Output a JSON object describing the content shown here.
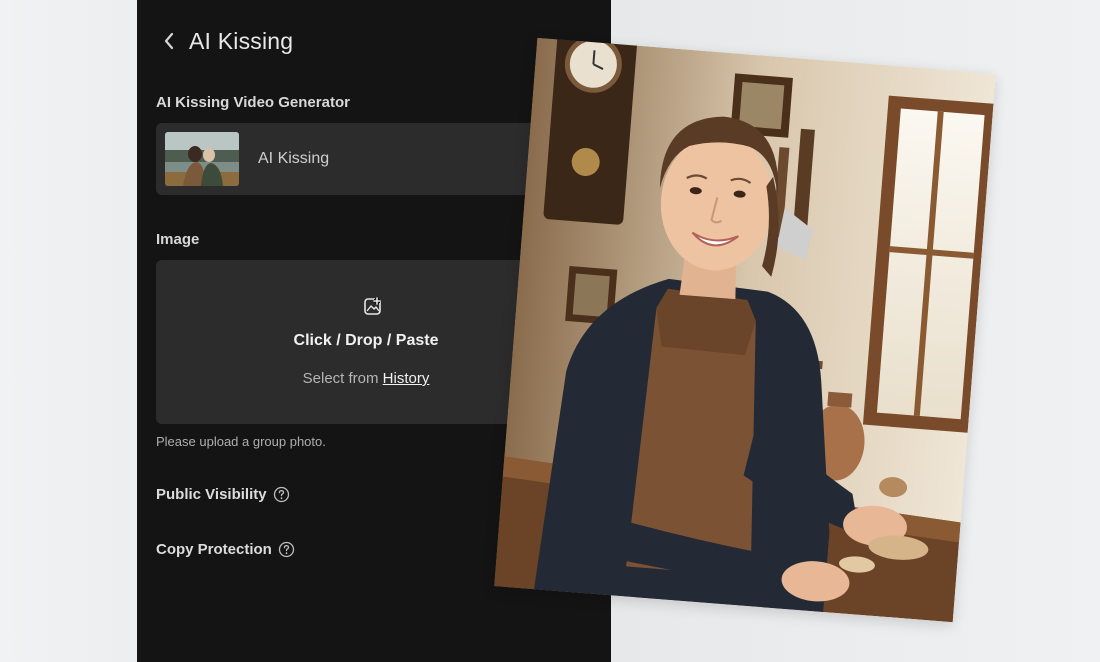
{
  "header": {
    "title": "AI Kissing"
  },
  "generator": {
    "label": "AI Kissing Video Generator",
    "template_name": "AI Kissing"
  },
  "image_section": {
    "label": "Image",
    "upload_main": "Click / Drop / Paste",
    "upload_sub_prefix": "Select from ",
    "history_link": "History",
    "hint": "Please upload a group photo."
  },
  "options": {
    "public_visibility": "Public Visibility",
    "copy_protection": "Copy Protection"
  },
  "icons": {
    "back": "chevron-left-icon",
    "template": "chevron-right-icon",
    "upload": "image-add-icon",
    "help": "help-circle-icon"
  }
}
